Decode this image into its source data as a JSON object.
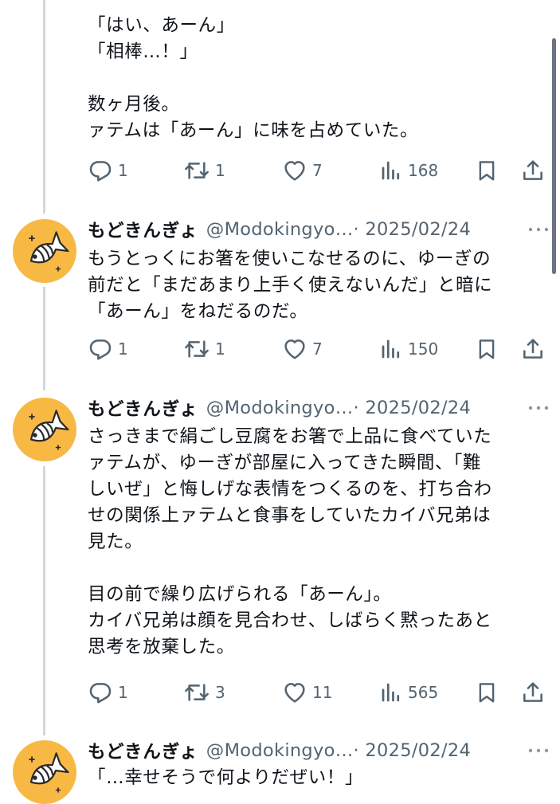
{
  "tweets": [
    {
      "lines": [
        "「はい、あーん」",
        "「相棒…！」",
        "",
        "数ヶ月後。",
        "ァテムは「あーん」に味を占めていた。"
      ],
      "replies": "1",
      "retweets": "1",
      "likes": "7",
      "views": "168"
    },
    {
      "name": "もどきんぎょ",
      "handle": "@Modokingyo…",
      "date": "· 2025/02/24",
      "lines": [
        "もうとっくにお箸を使いこなせるのに、ゆーぎの",
        "前だと「まだあまり上手く使えないんだ」と暗に",
        "「あーん」をねだるのだ。"
      ],
      "replies": "1",
      "retweets": "1",
      "likes": "7",
      "views": "150"
    },
    {
      "name": "もどきんぎょ",
      "handle": "@Modokingyo…",
      "date": "· 2025/02/24",
      "lines": [
        "さっきまで絹ごし豆腐をお箸で上品に食べていた",
        "ァテムが、ゆーぎが部屋に入ってきた瞬間、「難",
        "しいぜ」と悔しげな表情をつくるのを、打ち合わ",
        "せの関係上ァテムと食事をしていたカイバ兄弟は",
        "見た。",
        "",
        "目の前で繰り広げられる「あーん」。",
        "カイバ兄弟は顔を見合わせ、しばらく黙ったあと",
        "思考を放棄した。"
      ],
      "replies": "1",
      "retweets": "3",
      "likes": "11",
      "views": "565"
    },
    {
      "name": "もどきんぎょ",
      "handle": "@Modokingyo…",
      "date": "· 2025/02/24",
      "lines": [
        "「…幸せそうで何よりだぜい！」"
      ]
    }
  ],
  "icons": {
    "reply": "reply-icon",
    "retweet": "retweet-icon",
    "like": "heart-icon",
    "views": "views-icon",
    "bookmark": "bookmark-icon",
    "share": "share-icon",
    "more": "more-icon",
    "avatar": "fish-avatar-icon"
  },
  "colors": {
    "avatar_bg": "#f7b944",
    "text": "#0f1419",
    "muted": "#536471",
    "thread_line": "#cfd9de"
  }
}
